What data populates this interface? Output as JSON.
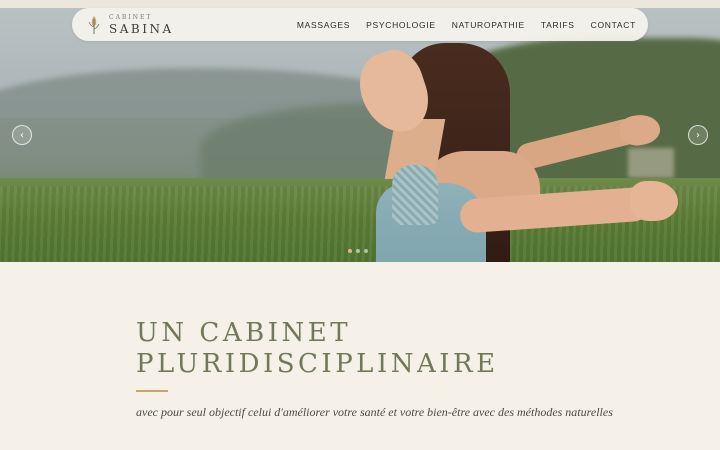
{
  "brand": {
    "small": "CABINET",
    "big": "SABINA"
  },
  "nav": {
    "items": [
      "MASSAGES",
      "PSYCHOLOGIE",
      "NATUROPATHIE",
      "TARIFS",
      "CONTACT"
    ]
  },
  "carousel": {
    "prev_icon": "chevron-left-icon",
    "next_icon": "chevron-right-icon",
    "prev_glyph": "‹",
    "next_glyph": "›",
    "slide_count": 3,
    "active_index": 0
  },
  "main": {
    "heading_line1": "UN CABINET",
    "heading_line2": "PLURIDISCIPLINAIRE",
    "subtitle": "avec pour seul objectif celui d'améliorer votre santé et votre bien-être avec des méthodes naturelles"
  },
  "colors": {
    "background": "#f5f0e8",
    "heading": "#6f7a57",
    "accent": "#c8a46c",
    "nav_text": "#2d2f29"
  }
}
